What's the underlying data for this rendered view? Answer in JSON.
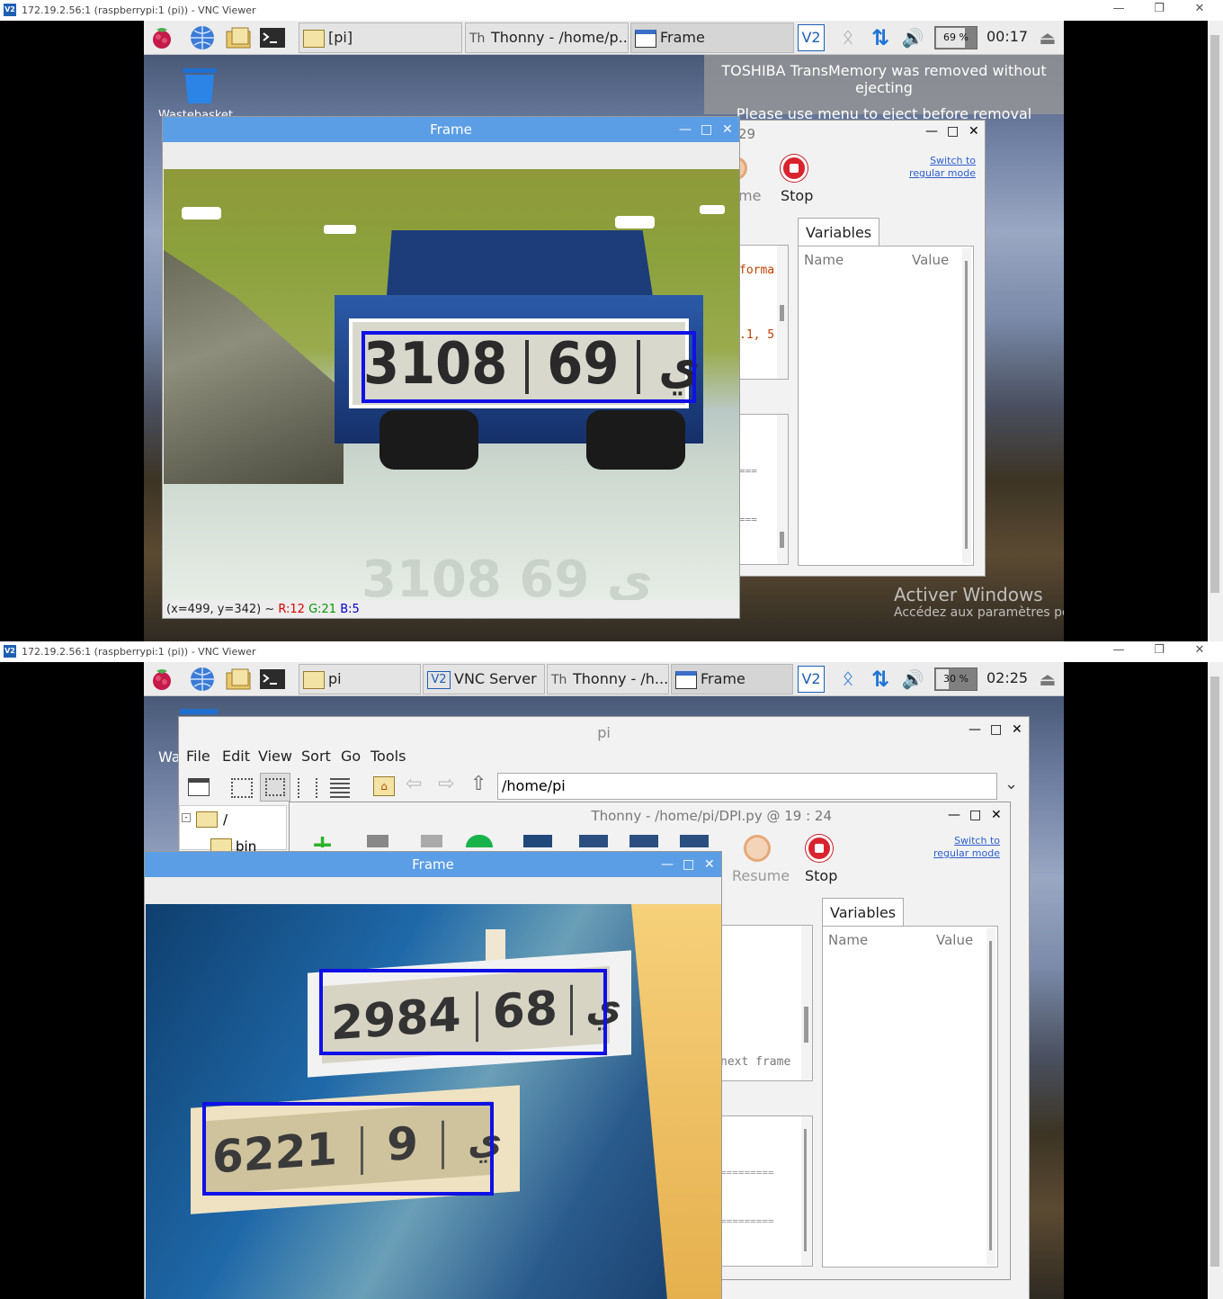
{
  "top": {
    "vnc_title": "172.19.2.56:1 (raspberrypi:1 (pi)) - VNC Viewer",
    "taskbar": {
      "btn_pi": "[pi]",
      "btn_thonny": "Thonny  -  /home/p...",
      "btn_frame": "Frame",
      "cpu": "69 %",
      "cpu_value": 0.69,
      "clock": "00:17"
    },
    "notification": {
      "line1": "TOSHIBA TransMemory was removed without ejecting",
      "line2": "Please use menu to eject before removal"
    },
    "trash_label": "Wastebasket",
    "frame": {
      "title": "Frame",
      "status_coords": "(x=499, y=342) ~ ",
      "r": "R:12",
      "g": "G:21",
      "b": "B:5",
      "plate": [
        "3108",
        "ﻱ",
        "69"
      ],
      "plate_reflection": "3108 ﻱ 69"
    },
    "thonny": {
      "title_fragment": "29",
      "resume_fragment": "me",
      "stop": "Stop",
      "switch1": "Switch to",
      "switch2": "regular mode",
      "variables_tab": "Variables",
      "col_name": "Name",
      "col_value": "Value",
      "code_a": "forma",
      "code_b": ".1, 5",
      "shell_a": "===",
      "shell_b": "==="
    },
    "watermark": {
      "line1": "Activer Windows",
      "line2": "Accédez aux paramètres pour activer Windows."
    }
  },
  "bottom": {
    "vnc_title": "172.19.2.56:1 (raspberrypi:1 (pi)) - VNC Viewer",
    "taskbar": {
      "btn_pi": "pi",
      "btn_vnc": "VNC Server",
      "btn_thonny": "Thonny  -  /h...",
      "btn_frame": "Frame",
      "cpu": "30 %",
      "cpu_value": 0.3,
      "clock": "02:25"
    },
    "desktop_fragment": "Wa",
    "filemanager": {
      "title": "pi",
      "menus": [
        "File",
        "Edit",
        "View",
        "Sort",
        "Go",
        "Tools"
      ],
      "path": "/home/pi",
      "tree_root": "/",
      "tree_bin": "bin"
    },
    "thonny": {
      "title": "Thonny  -  /home/pi/DPI.py  @  19 : 24",
      "resume": "Resume",
      "stop": "Stop",
      "switch1": "Switch to",
      "switch2": "regular mode",
      "variables_tab": "Variables",
      "col_name": "Name",
      "col_value": "Value",
      "code_a": "next frame",
      "shell_a": "=========",
      "shell_b": "========="
    },
    "frame": {
      "title": "Frame",
      "plate1": [
        "2984",
        "ﻱ",
        "68"
      ],
      "plate2": [
        "6221",
        "ﻱ",
        "9"
      ]
    }
  }
}
